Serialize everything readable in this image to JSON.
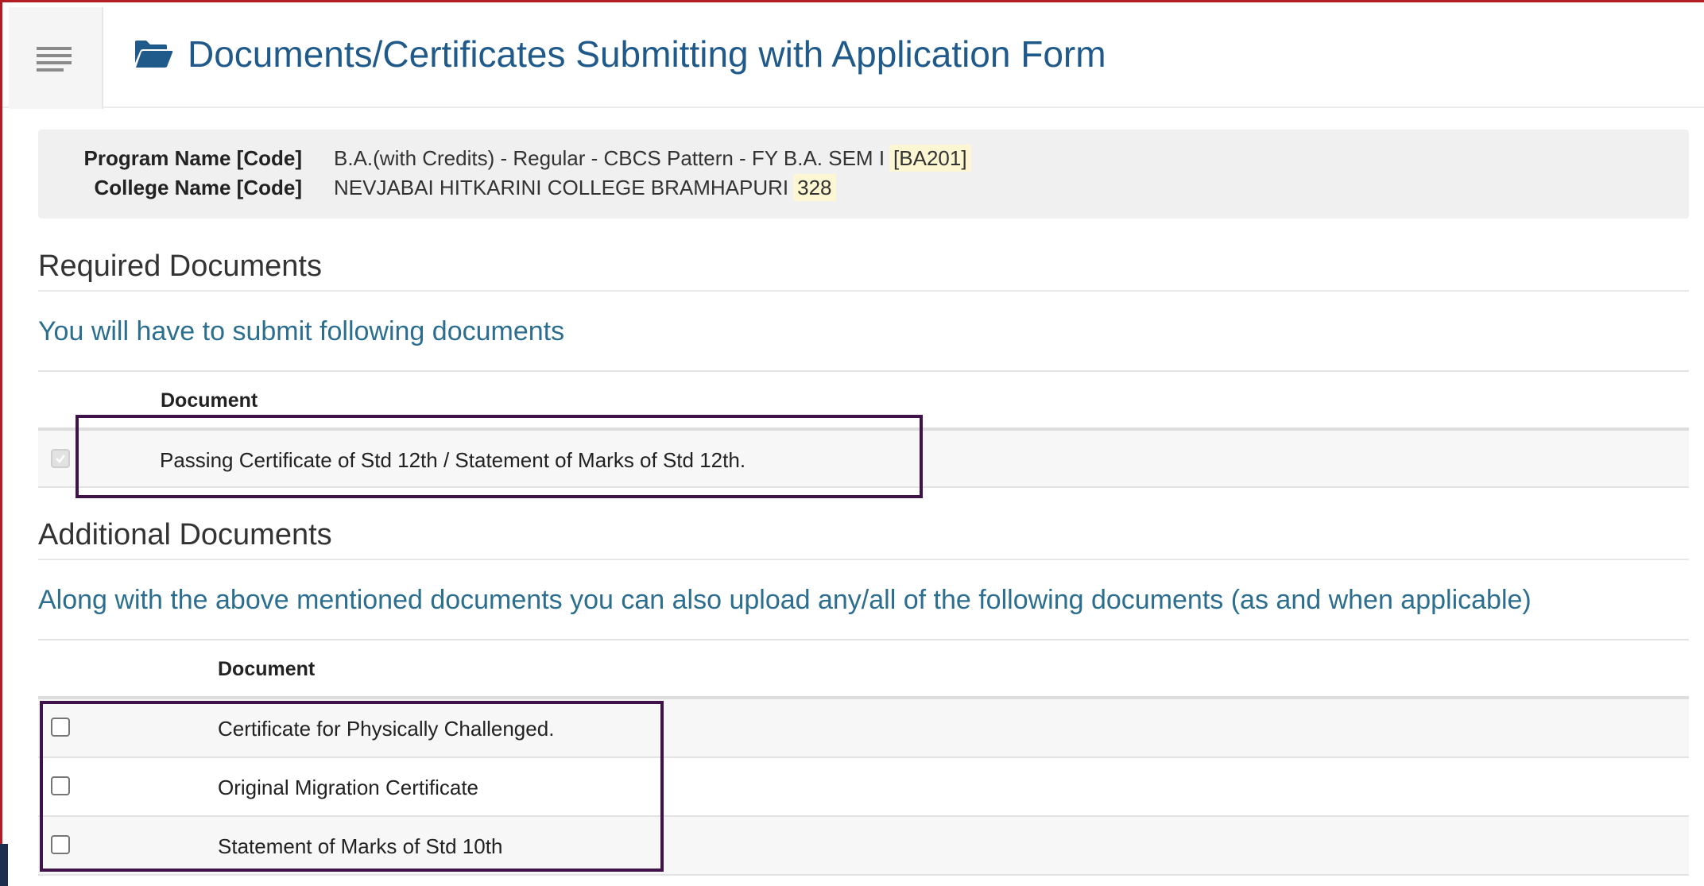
{
  "header": {
    "menu_icon": "hamburger-menu-icon",
    "title_icon": "folder-open-icon",
    "title": "Documents/Certificates Submitting with Application Form"
  },
  "info": {
    "program_label": "Program Name [Code]",
    "program_value": "B.A.(with Credits) - Regular - CBCS Pattern - FY B.A. SEM I",
    "program_code": "[BA201]",
    "college_label": "College Name [Code]",
    "college_value": "NEVJABAI HITKARINI COLLEGE BRAMHAPURI",
    "college_code": "328"
  },
  "required": {
    "heading": "Required Documents",
    "subtitle": "You will have to submit following documents",
    "column_header": "Document",
    "rows": [
      {
        "label": "Passing Certificate of Std 12th / Statement of Marks of Std 12th.",
        "checked": true,
        "disabled": true
      }
    ]
  },
  "additional": {
    "heading": "Additional Documents",
    "subtitle": "Along with the above mentioned documents you can also upload any/all of the following documents (as and when applicable)",
    "column_header": "Document",
    "rows": [
      {
        "label": "Certificate for Physically Challenged.",
        "checked": false
      },
      {
        "label": "Original Migration Certificate",
        "checked": false
      },
      {
        "label": "Statement of Marks of Std 10th",
        "checked": false
      }
    ]
  },
  "colors": {
    "frame": "#b01e23",
    "title": "#1f5a8b",
    "subtitle": "#2c6e8f",
    "highlight_box": "#3f1349",
    "code_badge_bg": "#fdf6d3"
  }
}
